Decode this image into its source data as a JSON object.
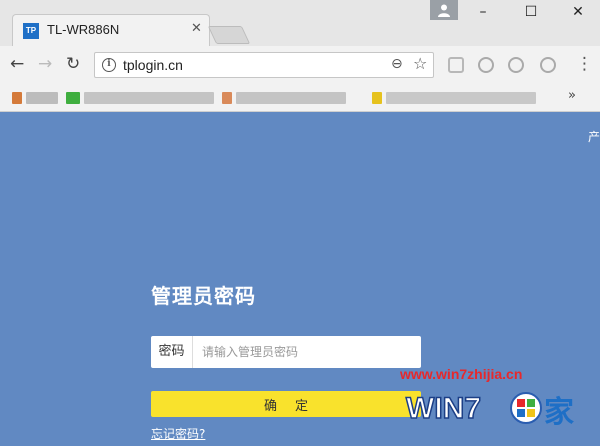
{
  "browser": {
    "tab_title": "TL-WR886N",
    "favicon_text": "TP",
    "url": "tplogin.cn",
    "window_controls": {
      "minimize": "–",
      "maximize": "☐",
      "close": "✕"
    }
  },
  "page": {
    "product_link": "产",
    "title": "管理员密码",
    "password": {
      "label": "密码",
      "placeholder": "请输入管理员密码",
      "value": ""
    },
    "confirm_label": "确定",
    "forgot_link": "忘记密码?"
  },
  "watermark": {
    "url_text": "www.win7zhijia.cn",
    "logo_text": "WIN7",
    "logo_suffix": "家"
  },
  "colors": {
    "page_bg": "#6189c2",
    "confirm_bg": "#f9e22c",
    "watermark_red": "#e8282b",
    "favicon_bg": "#1e6fc6"
  }
}
